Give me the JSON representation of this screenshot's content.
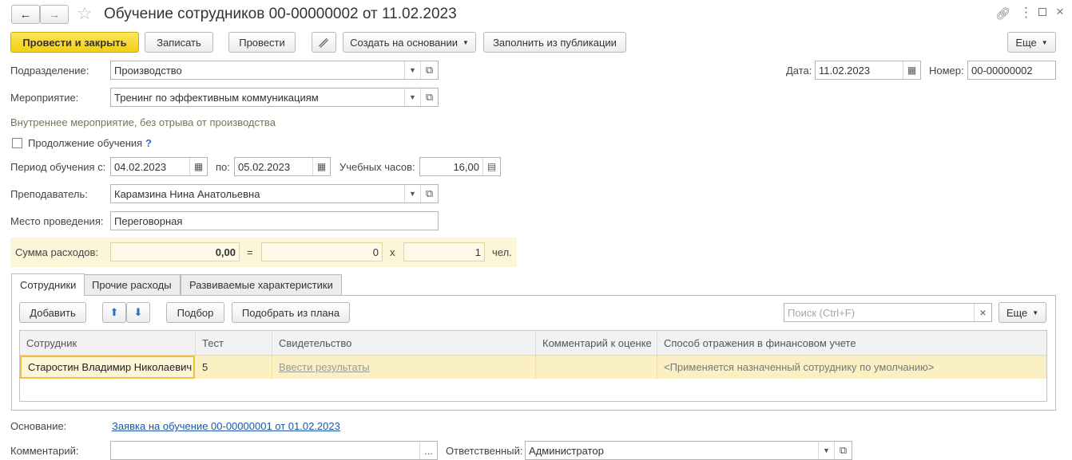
{
  "window": {
    "title": "Обучение сотрудников 00-00000002 от 11.02.2023"
  },
  "toolbar": {
    "post_close": "Провести и закрыть",
    "save": "Записать",
    "post": "Провести",
    "create_based": "Создать на основании",
    "fill_publication": "Заполнить из публикации",
    "more": "Еще"
  },
  "form": {
    "division_label": "Подразделение:",
    "division_value": "Производство",
    "date_label": "Дата:",
    "date_value": "11.02.2023",
    "number_label": "Номер:",
    "number_value": "00-00000002",
    "event_label": "Мероприятие:",
    "event_value": "Тренинг по эффективным коммуникациям",
    "event_note": "Внутреннее мероприятие, без отрыва от производства",
    "continuation_label": "Продолжение обучения",
    "continuation_help": "?",
    "period_label": "Период обучения с:",
    "period_from": "04.02.2023",
    "period_to_label": "по:",
    "period_to": "05.02.2023",
    "hours_label": "Учебных часов:",
    "hours_value": "16,00",
    "teacher_label": "Преподаватель:",
    "teacher_value": "Карамзина Нина Анатольевна",
    "place_label": "Место проведения:",
    "place_value": "Переговорная",
    "cost_label": "Сумма расходов:",
    "cost_total": "0,00",
    "equals": "=",
    "cost_per": "0",
    "times": "х",
    "people": "1",
    "people_unit": "чел."
  },
  "tabs": [
    {
      "label": "Сотрудники"
    },
    {
      "label": "Прочие расходы"
    },
    {
      "label": "Развиваемые характеристики"
    }
  ],
  "table_toolbar": {
    "add": "Добавить",
    "select": "Подбор",
    "select_plan": "Подобрать из плана",
    "search_placeholder": "Поиск (Ctrl+F)",
    "clear": "×",
    "more": "Еще"
  },
  "table": {
    "columns": [
      "Сотрудник",
      "Тест",
      "Свидетельство",
      "Комментарий к оценке",
      "Способ отражения в финансовом учете"
    ],
    "rows": [
      [
        "Старостин Владимир Николаевич",
        "5",
        "Ввести результаты",
        "",
        "<Применяется назначенный сотруднику по умолчанию>"
      ]
    ]
  },
  "footer": {
    "basis_label": "Основание:",
    "basis_link": "Заявка на обучение 00-00000001 от 01.02.2023",
    "comment_label": "Комментарий:",
    "comment_value": "",
    "comment_btn": "...",
    "responsible_label": "Ответственный:",
    "responsible_value": "Администратор"
  },
  "colors": {
    "primary_button": "#f3cf16",
    "selected_row": "#fbf0c4",
    "link": "#1a56a6",
    "note": "#6d7a55",
    "cost_bg": "#fbf6d8"
  },
  "icons": [
    "back-arrow-icon",
    "forward-arrow-icon",
    "star-icon",
    "link-icon",
    "more-dots-icon",
    "maximize-icon",
    "close-icon",
    "paperclip-icon",
    "dropdown-arrow-icon",
    "calendar-icon",
    "open-icon",
    "calculator-icon",
    "help-icon",
    "arrow-up-icon",
    "arrow-down-icon"
  ]
}
